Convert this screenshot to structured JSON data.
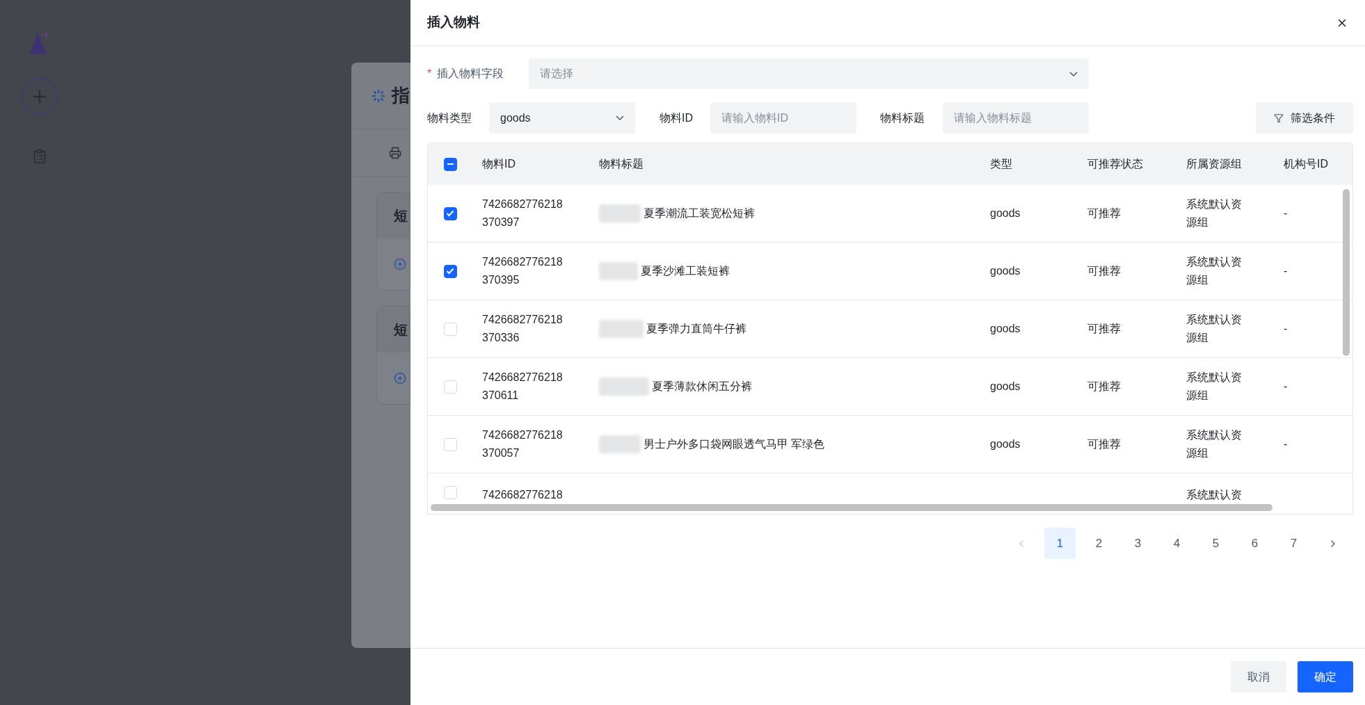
{
  "background": {
    "panel_title": "指",
    "sections": [
      {
        "title": "短"
      },
      {
        "title": "短"
      }
    ]
  },
  "dialog": {
    "title": "插入物料"
  },
  "field": {
    "label": "插入物料字段",
    "required_mark": "*",
    "placeholder": "请选择"
  },
  "filters": {
    "type": {
      "label": "物料类型",
      "value": "goods"
    },
    "id": {
      "label": "物料ID",
      "placeholder": "请输入物料ID"
    },
    "title": {
      "label": "物料标题",
      "placeholder": "请输入物料标题"
    },
    "button": "筛选条件"
  },
  "table": {
    "header_checkbox": {
      "indeterminate": true
    },
    "columns": [
      "物料ID",
      "物料标题",
      "类型",
      "可推荐状态",
      "所属资源组",
      "机构号ID"
    ],
    "rows": [
      {
        "checked": true,
        "id_lines": [
          "7426682776218",
          "370397"
        ],
        "title": "夏季潮流工装宽松短裤",
        "type": "goods",
        "status": "可推荐",
        "group_lines": [
          "系统默认资",
          "源组"
        ],
        "org_id": "-"
      },
      {
        "checked": true,
        "id_lines": [
          "7426682776218",
          "370395"
        ],
        "title": "夏季沙滩工装短裤",
        "type": "goods",
        "status": "可推荐",
        "group_lines": [
          "系统默认资",
          "源组"
        ],
        "org_id": "-"
      },
      {
        "checked": false,
        "id_lines": [
          "7426682776218",
          "370336"
        ],
        "title": "夏季弹力直筒牛仔裤",
        "type": "goods",
        "status": "可推荐",
        "group_lines": [
          "系统默认资",
          "源组"
        ],
        "org_id": "-"
      },
      {
        "checked": false,
        "id_lines": [
          "7426682776218",
          "370611"
        ],
        "title": "夏季薄款休闲五分裤",
        "type": "goods",
        "status": "可推荐",
        "group_lines": [
          "系统默认资",
          "源组"
        ],
        "org_id": "-"
      },
      {
        "checked": false,
        "id_lines": [
          "7426682776218",
          "370057"
        ],
        "title": "男士户外多口袋网眼透气马甲 军绿色",
        "type": "goods",
        "status": "可推荐",
        "group_lines": [
          "系统默认资",
          "源组"
        ],
        "org_id": "-"
      },
      {
        "checked": false,
        "id_lines": [
          "7426682776218"
        ],
        "group_lines": [
          "系统默认资"
        ]
      }
    ]
  },
  "pagination": {
    "prev": {
      "disabled": true
    },
    "next": {
      "disabled": false
    },
    "pages": [
      {
        "label": "1",
        "selected": true
      },
      {
        "label": "2",
        "selected": false
      },
      {
        "label": "3",
        "selected": false
      },
      {
        "label": "4",
        "selected": false
      },
      {
        "label": "5",
        "selected": false
      },
      {
        "label": "6",
        "selected": false
      },
      {
        "label": "7",
        "selected": false
      }
    ]
  },
  "footer": {
    "cancel": "取消",
    "confirm": "确定"
  }
}
